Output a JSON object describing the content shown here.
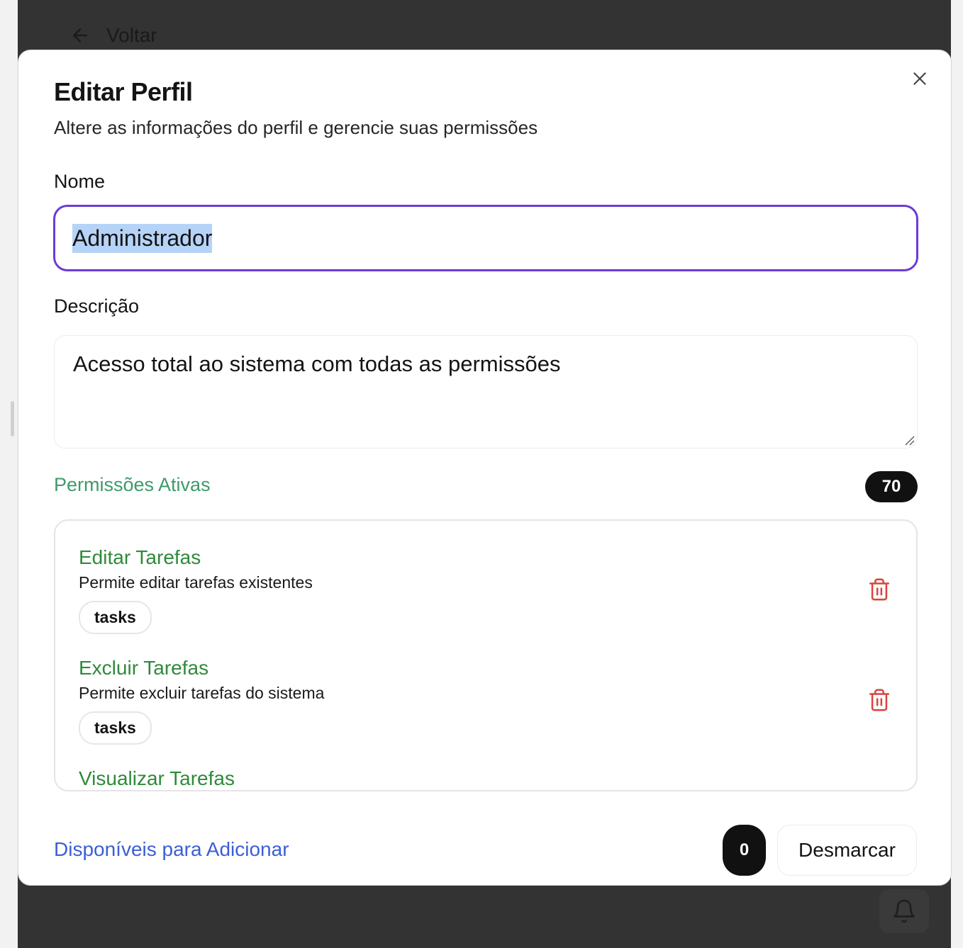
{
  "background": {
    "back_label": "Voltar"
  },
  "modal": {
    "title": "Editar Perfil",
    "subtitle": "Altere as informações do perfil e gerencie suas permissões",
    "name_label": "Nome",
    "name_value": "Administrador",
    "description_label": "Descrição",
    "description_value": "Acesso total ao sistema com todas as permissões",
    "active_permissions": {
      "title": "Permissões Ativas",
      "count": "70",
      "items": [
        {
          "name": "Editar Tarefas",
          "description": "Permite editar tarefas existentes",
          "tag": "tasks"
        },
        {
          "name": "Excluir Tarefas",
          "description": "Permite excluir tarefas do sistema",
          "tag": "tasks"
        },
        {
          "name": "Visualizar Tarefas",
          "description": "",
          "tag": ""
        }
      ]
    },
    "available": {
      "title": "Disponíveis para Adicionar",
      "selected_count": "0",
      "uncheck_label": "Desmarcar"
    }
  },
  "colors": {
    "focus_border": "#6b3cd6",
    "permission_name": "#2f8a3a",
    "active_title": "#3f9a6a",
    "available_title": "#3b5fd6",
    "delete_icon": "#d9463e"
  },
  "icons": [
    "arrow-left-icon",
    "close-icon",
    "trash-icon",
    "bell-icon"
  ]
}
